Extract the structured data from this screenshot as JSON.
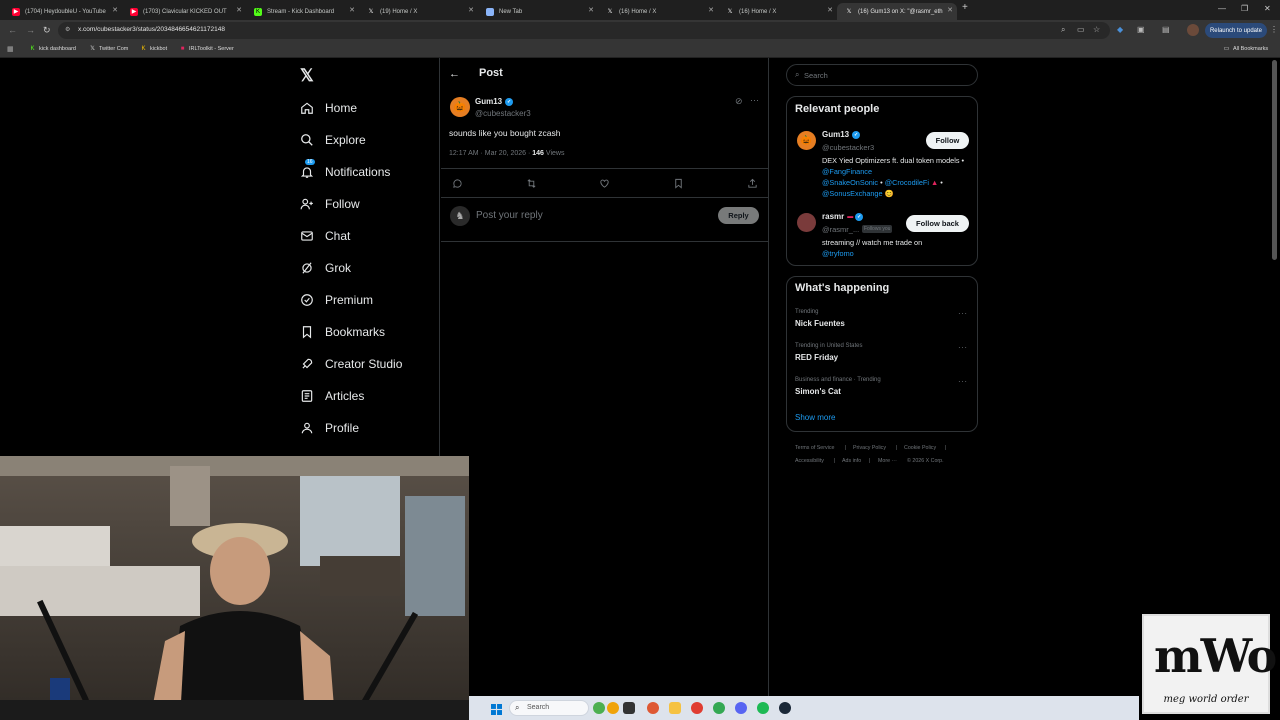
{
  "browser": {
    "tabs": [
      {
        "title": "(1704) HeydoubleU - YouTube",
        "favicon_color": "#ff0033"
      },
      {
        "title": "(1703) Clavicular KICKED OUT",
        "favicon_color": "#ff0033"
      },
      {
        "title": "Stream - Kick Dashboard",
        "favicon_color": "#53fc18"
      },
      {
        "title": "(19) Home / X",
        "favicon_color": "#ffffff"
      },
      {
        "title": "New Tab",
        "favicon_color": "#8ab4f8"
      },
      {
        "title": "(16) Home / X",
        "favicon_color": "#ffffff"
      },
      {
        "title": "(16) Home / X",
        "favicon_color": "#ffffff"
      },
      {
        "title": "(16) Gum13 on X: \"@rasmr_eth",
        "favicon_color": "#ffffff"
      }
    ],
    "url": "x.com/cubestacker3/status/2034846654621172148",
    "relaunch_label": "Relaunch to update",
    "bookmarks": [
      {
        "label": "kick dashboard",
        "color": "#53fc18"
      },
      {
        "label": "Twitter Com",
        "color": "#ffffff"
      },
      {
        "label": "kickbot",
        "color": "#f7c200"
      },
      {
        "label": "IRLToolkit - Server",
        "color": "#e0245e"
      }
    ],
    "all_bookmarks_label": "All Bookmarks"
  },
  "nav": {
    "items": [
      {
        "label": "Home",
        "icon": "home-icon"
      },
      {
        "label": "Explore",
        "icon": "search-icon"
      },
      {
        "label": "Notifications",
        "icon": "bell-icon",
        "badge": "16"
      },
      {
        "label": "Follow",
        "icon": "follow-icon"
      },
      {
        "label": "Chat",
        "icon": "mail-icon"
      },
      {
        "label": "Grok",
        "icon": "grok-icon"
      },
      {
        "label": "Premium",
        "icon": "premium-icon"
      },
      {
        "label": "Bookmarks",
        "icon": "bookmark-icon"
      },
      {
        "label": "Creator Studio",
        "icon": "rocket-icon"
      },
      {
        "label": "Articles",
        "icon": "article-icon"
      },
      {
        "label": "Profile",
        "icon": "person-icon"
      }
    ]
  },
  "post": {
    "header": "Post",
    "author_name": "Gum13",
    "author_handle": "@cubestacker3",
    "text": "sounds like you bought zcash",
    "time": "12:17 AM · Mar 20, 2026 · ",
    "views_count": "146",
    "views_label": " Views",
    "reply_placeholder": "Post your reply",
    "reply_button": "Reply"
  },
  "search": {
    "placeholder": "Search"
  },
  "relevant": {
    "title": "Relevant people",
    "people": [
      {
        "name": "Gum13",
        "handle": "@cubestacker3",
        "button": "Follow",
        "bio_text": "DEX Yied Optimizers ft. dual token models • ",
        "bio_link1": "@FangFinance",
        "bio_link2": "@SnakeOnSonic",
        "bio_link3": "@CrocodileFi",
        "bio_link4": "@SonusExchange"
      },
      {
        "name": "rasmr",
        "handle": "@rasmr_...",
        "follows_you": "Follows you",
        "button": "Follow back",
        "bio_text": "streaming // watch me trade on",
        "bio_link1": "@tryfomo"
      }
    ]
  },
  "happening": {
    "title": "What's happening",
    "trends": [
      {
        "meta": "Trending",
        "name": "Nick Fuentes"
      },
      {
        "meta": "Trending in United States",
        "name": "RED Friday"
      },
      {
        "meta": "Business and finance · Trending",
        "name": "Simon's Cat"
      }
    ],
    "show_more": "Show more"
  },
  "footer": {
    "links": [
      "Terms of Service",
      "Privacy Policy",
      "Cookie Policy",
      "Accessibility",
      "Ads info",
      "More ···",
      "© 2026 X Corp."
    ]
  },
  "taskbar": {
    "search_label": "Search"
  },
  "overlay_logo": {
    "text": "mWo",
    "subtitle": "meg world order"
  }
}
